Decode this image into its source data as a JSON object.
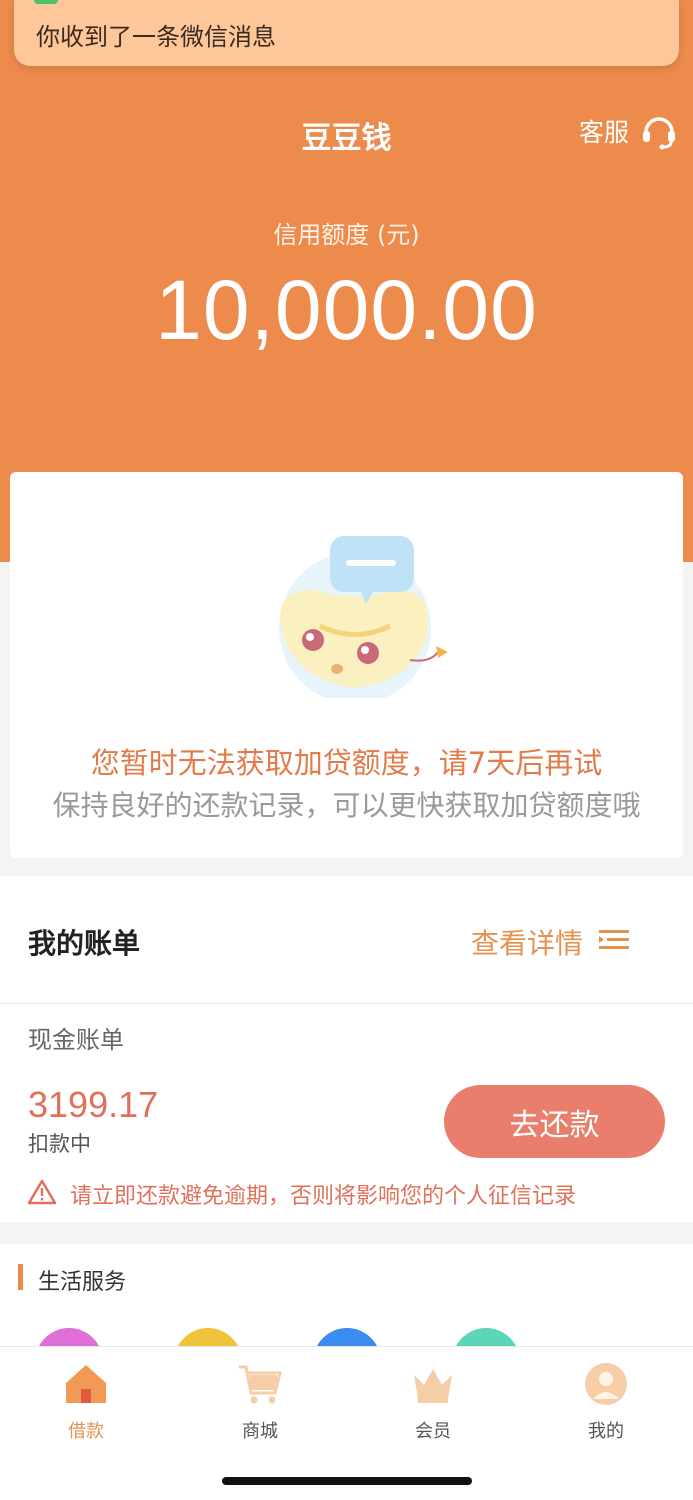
{
  "notification": {
    "text": "你收到了一条微信消息"
  },
  "header": {
    "title": "豆豆钱",
    "service_label": "客服",
    "limit_label": "信用额度 (元)",
    "limit_value": "10,000.00"
  },
  "notice": {
    "main_message": "您暂时无法获取加贷额度，请7天后再试",
    "sub_message": "保持良好的还款记录，可以更快获取加贷额度哦"
  },
  "bills": {
    "title": "我的账单",
    "detail_label": "查看详情",
    "cash_bill_label": "现金账单",
    "amount": "3199.17",
    "status": "扣款中",
    "pay_button": "去还款",
    "warning": "请立即还款避免逾期，否则将影响您的个人征信记录"
  },
  "life_services": {
    "title": "生活服务",
    "icon_colors": [
      "#e070d8",
      "#f0c43a",
      "#3a8cf0",
      "#5cd6b8"
    ]
  },
  "tabbar": {
    "items": [
      {
        "label": "借款",
        "icon": "home-icon",
        "active": true
      },
      {
        "label": "商城",
        "icon": "cart-icon",
        "active": false
      },
      {
        "label": "会员",
        "icon": "crown-icon",
        "active": false
      },
      {
        "label": "我的",
        "icon": "user-icon",
        "active": false
      }
    ]
  },
  "colors": {
    "brand": "#ec8b4c",
    "accent_text": "#e5924f",
    "alert": "#e0705a"
  }
}
